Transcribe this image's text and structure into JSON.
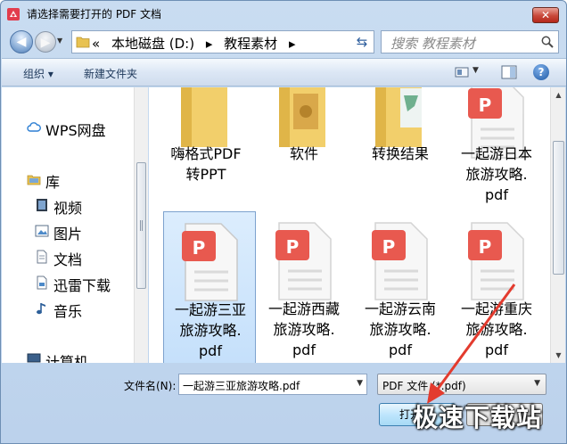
{
  "title": "请选择需要打开的 PDF 文档",
  "address": {
    "prefix": "«",
    "crumbs": [
      "本地磁盘 (D:)",
      "▸",
      "教程素材",
      "▸"
    ]
  },
  "search": {
    "placeholder": "搜索 教程素材"
  },
  "toolbar": {
    "organize": "组织 ▾",
    "new_folder": "新建文件夹"
  },
  "nav": {
    "items": [
      {
        "label": "WPS网盘",
        "icon": "cloud-icon"
      },
      {
        "label": "库",
        "icon": "library-icon"
      },
      {
        "label": "视频",
        "icon": "video-icon"
      },
      {
        "label": "图片",
        "icon": "picture-icon"
      },
      {
        "label": "文档",
        "icon": "document-icon"
      },
      {
        "label": "迅雷下载",
        "icon": "download-icon"
      },
      {
        "label": "音乐",
        "icon": "music-icon"
      },
      {
        "label": "计算机",
        "icon": "computer-icon"
      }
    ]
  },
  "files": {
    "row1": [
      {
        "lines": [
          "嗨格式PDF",
          "转PPT"
        ],
        "kind": "folder"
      },
      {
        "lines": [
          "软件"
        ],
        "kind": "folder"
      },
      {
        "lines": [
          "转换结果"
        ],
        "kind": "folder"
      },
      {
        "lines": [
          "一起游日本",
          "旅游攻略.",
          "pdf"
        ],
        "kind": "pdf"
      }
    ],
    "row2": [
      {
        "lines": [
          "一起游三亚",
          "旅游攻略.",
          "pdf"
        ],
        "kind": "pdf",
        "selected": true
      },
      {
        "lines": [
          "一起游西藏",
          "旅游攻略.",
          "pdf"
        ],
        "kind": "pdf"
      },
      {
        "lines": [
          "一起游云南",
          "旅游攻略.",
          "pdf"
        ],
        "kind": "pdf"
      },
      {
        "lines": [
          "一起游重庆",
          "旅游攻略.",
          "pdf"
        ],
        "kind": "pdf"
      }
    ]
  },
  "filename": {
    "label": "文件名(N):",
    "value": "一起游三亚旅游攻略.pdf"
  },
  "filetype": {
    "value": "PDF 文件 (*.pdf)"
  },
  "buttons": {
    "open": "打开"
  },
  "watermark": "极速下载站",
  "colors": {
    "pdf_red": "#e8594f",
    "folder_yellow": "#f2cf6b",
    "accent_arrow": "#e33b2e"
  }
}
